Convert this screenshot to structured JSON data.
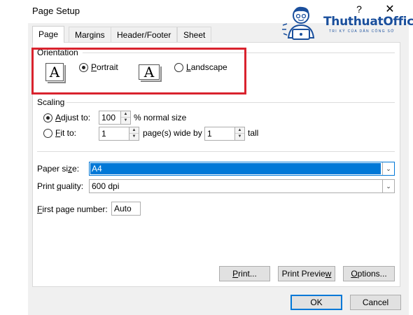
{
  "window": {
    "title": "Page Setup",
    "help": "?",
    "close": "✕"
  },
  "logo": {
    "name": "ThuthuatOffice",
    "tagline": "TRI KỶ CỦA DÂN CÔNG SỞ"
  },
  "tabs": [
    {
      "label": "Page",
      "active": true
    },
    {
      "label": "Margins",
      "active": false
    },
    {
      "label": "Header/Footer",
      "active": false
    },
    {
      "label": "Sheet",
      "active": false
    }
  ],
  "orientation": {
    "group_label": "Orientation",
    "portrait": {
      "glyph": "A",
      "accel": "P",
      "rest": "ortrait",
      "checked": true
    },
    "landscape": {
      "glyph": "A",
      "accel": "L",
      "rest": "andscape",
      "checked": false
    }
  },
  "scaling": {
    "group_label": "Scaling",
    "adjust": {
      "accel": "A",
      "rest": "djust to:",
      "value": "100",
      "suffix": "% normal size",
      "checked": true
    },
    "fit": {
      "accel": "F",
      "rest": "it to:",
      "wide_value": "1",
      "wide_suffix": "page(s) wide by",
      "tall_value": "1",
      "tall_suffix": "tall",
      "checked": false
    }
  },
  "paper_size": {
    "label_pre": "Paper si",
    "accel": "z",
    "label_post": "e:",
    "value": "A4"
  },
  "print_quality": {
    "label_pre": "Print ",
    "accel": "q",
    "label_post": "uality:",
    "value": "600 dpi"
  },
  "first_page": {
    "accel": "F",
    "label_post": "irst page number:",
    "value": "Auto"
  },
  "buttons": {
    "print": {
      "accel": "P",
      "rest": "rint..."
    },
    "preview": {
      "pre": "Print Previe",
      "accel": "w"
    },
    "options": {
      "accel": "O",
      "rest": "ptions..."
    },
    "ok": "OK",
    "cancel": "Cancel"
  },
  "colors": {
    "highlight": "#d9232e",
    "selection": "#0078d7",
    "brand": "#1a4f9c"
  }
}
